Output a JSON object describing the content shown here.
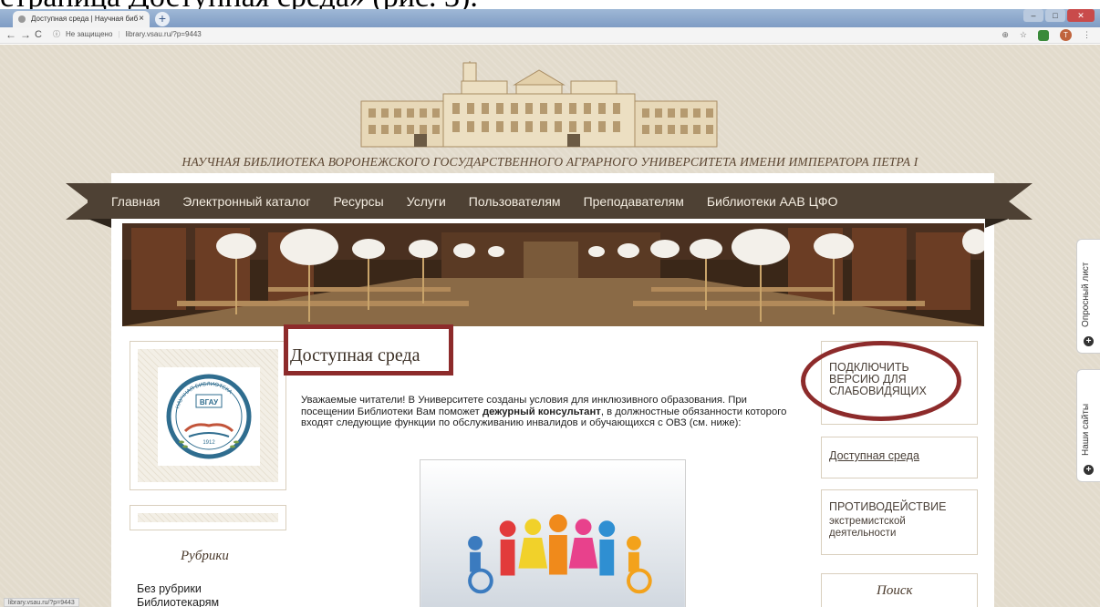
{
  "caption_text": "страница Доступная среда» (рис. 3).",
  "browser": {
    "tab_title": "Доступная среда | Научная биб",
    "tab_close": "×",
    "new_tab": "+",
    "back": "←",
    "forward": "→",
    "reload": "C",
    "security_icon": "ⓘ",
    "security_label": "Не защищено",
    "url": "library.vsau.ru/?p=9443",
    "zoom": "⊕",
    "star": "☆",
    "profile_letter": "T",
    "menu": "⋮",
    "status_url": "library.vsau.ru/?p=9443"
  },
  "site": {
    "title": "НАУЧНАЯ БИБЛИОТЕКА ВОРОНЕЖСКОГО ГОСУДАРСТВЕННОГО АГРАРНОГО УНИВЕРСИТЕТА ИМЕНИ ИМПЕРАТОРА  ПЕТРА I"
  },
  "nav": {
    "items": [
      "Главная",
      "Электронный каталог",
      "Ресурсы",
      "Услуги",
      "Пользователям",
      "Преподавателям",
      "Библиотеки ААВ ЦФО"
    ]
  },
  "logo": {
    "top_text": "НАУЧНАЯ БИБЛИОТЕКА",
    "center_text": "ВГАУ",
    "year": "1912"
  },
  "main": {
    "heading": "Доступная среда",
    "intro_part1": "Уважаемые читатели! В Университете созданы условия для инклюзивного образования. При посещении Библиотеки Вам поможет ",
    "intro_bold": "дежурный  консультант",
    "intro_part2": ", в должностные обязанности которого входят следующие функции по обслуживанию инвалидов и обучающихся с ОВЗ (см. ниже):"
  },
  "rubrics": {
    "title": "Рубрики",
    "items": [
      "Без рубрики",
      "Библиотекарям"
    ]
  },
  "right_sidebar": {
    "low_vision_link": "ПОДКЛЮЧИТЬ ВЕРСИЮ ДЛЯ СЛАБОВИДЯЩИХ",
    "accessible_link": "Доступная среда",
    "counter_title": "ПРОТИВОДЕЙСТВИЕ",
    "counter_sub": "экстремистской деятельности",
    "search_title": "Поиск"
  },
  "side_tabs": {
    "survey": "Опросный лист",
    "our_sites": "Наши сайты",
    "plus": "+"
  },
  "colors": {
    "nav_bg": "#4e4134",
    "highlight": "#8d2b2b",
    "page_bg": "#e2dbcc"
  }
}
